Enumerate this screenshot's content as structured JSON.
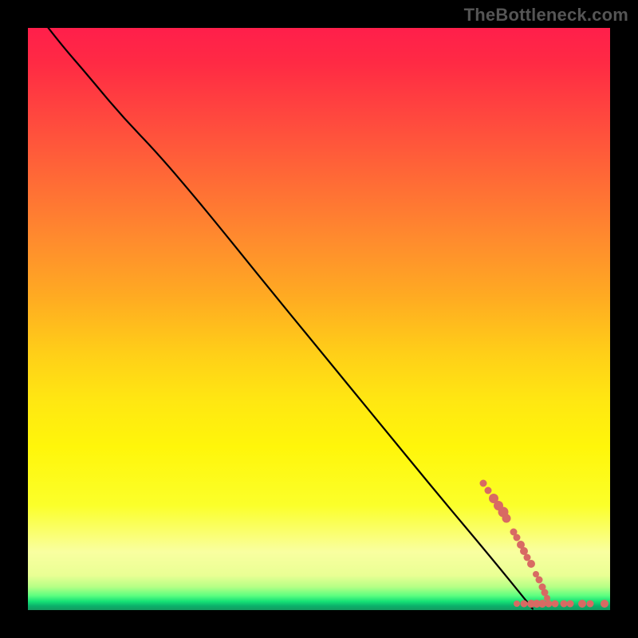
{
  "watermark": "TheBottleneck.com",
  "chart_data": {
    "type": "scatter",
    "title": "",
    "xlabel": "",
    "ylabel": "",
    "x_range_pct": [
      0,
      100
    ],
    "y_range_pct": [
      0,
      100
    ],
    "note": "No numeric axes/ticks are shown in the image; data given as approximate percentage positions within the plot area (origin top-left). Curve is a black line from top-left with a knee ~23% across, descending to bottom-right. Scatter points are salmon dots/pills clustered near the bottom-right, roughly along the curve's tail and along the bottom edge.",
    "curve_pts_pct": [
      [
        3.5,
        0
      ],
      [
        6,
        3.2
      ],
      [
        10,
        7.8
      ],
      [
        16,
        15
      ],
      [
        22.5,
        21.8
      ],
      [
        30,
        30.6
      ],
      [
        40,
        43
      ],
      [
        50,
        55.2
      ],
      [
        60,
        67.4
      ],
      [
        70,
        79.6
      ],
      [
        80,
        91.5
      ],
      [
        86.7,
        99.8
      ]
    ],
    "scatter_points": [
      {
        "x_pct": 78.2,
        "y_pct": 78.2,
        "d": 9
      },
      {
        "x_pct": 79.0,
        "y_pct": 79.4,
        "d": 9
      },
      {
        "x_pct": 80.0,
        "y_pct": 80.8,
        "d": 12
      },
      {
        "x_pct": 80.8,
        "y_pct": 82.0,
        "d": 12
      },
      {
        "x_pct": 81.6,
        "y_pct": 83.2,
        "d": 13
      },
      {
        "x_pct": 82.2,
        "y_pct": 84.3,
        "d": 11
      },
      {
        "x_pct": 83.4,
        "y_pct": 86.6,
        "d": 9
      },
      {
        "x_pct": 84.0,
        "y_pct": 87.6,
        "d": 9
      },
      {
        "x_pct": 84.6,
        "y_pct": 88.8,
        "d": 10
      },
      {
        "x_pct": 85.2,
        "y_pct": 89.9,
        "d": 10
      },
      {
        "x_pct": 85.8,
        "y_pct": 90.9,
        "d": 9
      },
      {
        "x_pct": 86.4,
        "y_pct": 92.0,
        "d": 10
      },
      {
        "x_pct": 87.3,
        "y_pct": 93.8,
        "d": 8
      },
      {
        "x_pct": 87.8,
        "y_pct": 94.8,
        "d": 9
      },
      {
        "x_pct": 88.4,
        "y_pct": 96.0,
        "d": 9
      },
      {
        "x_pct": 88.8,
        "y_pct": 97.0,
        "d": 9
      },
      {
        "x_pct": 89.2,
        "y_pct": 97.9,
        "d": 8
      },
      {
        "x_pct": 84.0,
        "y_pct": 98.9,
        "d": 8
      },
      {
        "x_pct": 85.2,
        "y_pct": 98.9,
        "d": 9
      },
      {
        "x_pct": 86.4,
        "y_pct": 98.9,
        "d": 10
      },
      {
        "x_pct": 87.4,
        "y_pct": 98.9,
        "d": 10
      },
      {
        "x_pct": 88.4,
        "y_pct": 98.9,
        "d": 10
      },
      {
        "x_pct": 89.4,
        "y_pct": 98.9,
        "d": 9
      },
      {
        "x_pct": 90.6,
        "y_pct": 98.9,
        "d": 9
      },
      {
        "x_pct": 92.0,
        "y_pct": 98.9,
        "d": 9
      },
      {
        "x_pct": 93.2,
        "y_pct": 98.9,
        "d": 9
      },
      {
        "x_pct": 95.2,
        "y_pct": 98.9,
        "d": 10
      },
      {
        "x_pct": 96.6,
        "y_pct": 98.9,
        "d": 9
      },
      {
        "x_pct": 99.0,
        "y_pct": 98.9,
        "d": 10
      }
    ],
    "marker_color": "#d86a63",
    "curve_color": "#000000"
  }
}
